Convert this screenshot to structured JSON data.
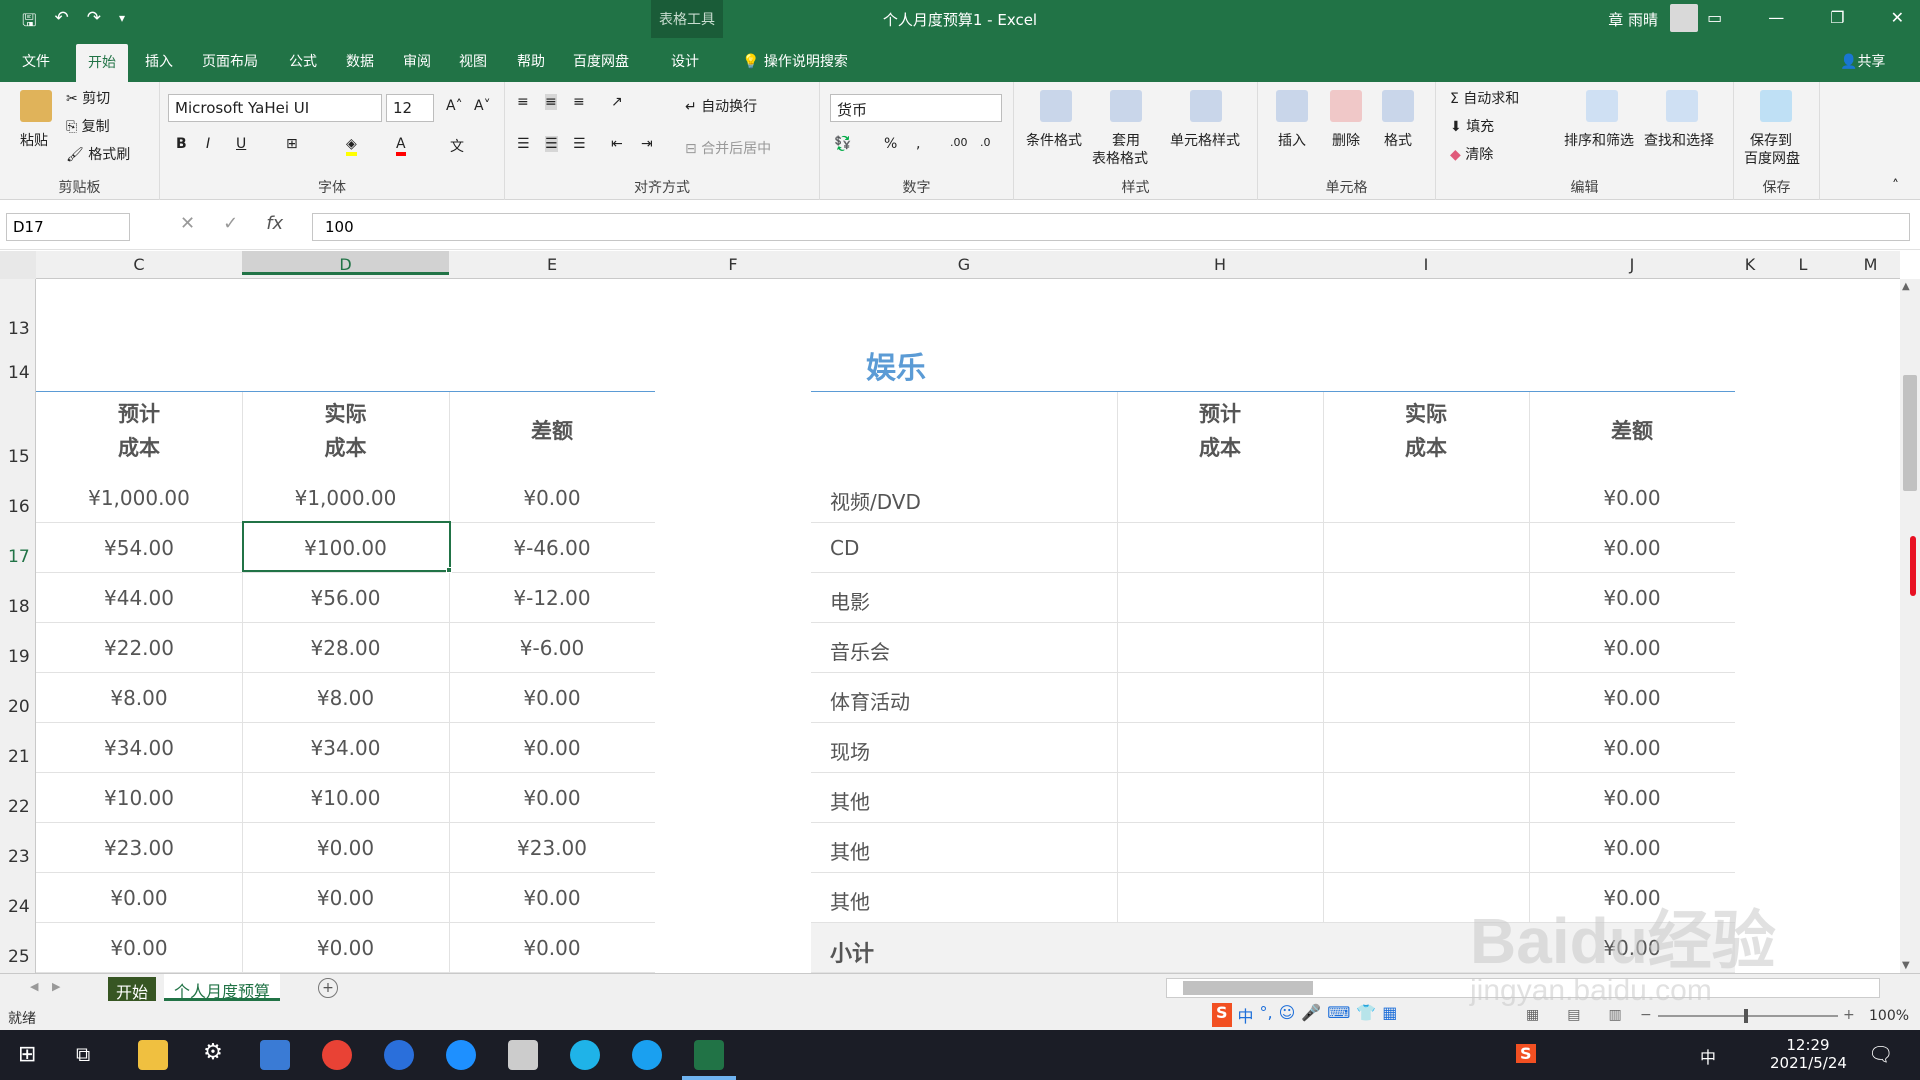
{
  "window": {
    "title": "个人月度预算1 - Excel",
    "context_tab": "表格工具",
    "user": "章 雨晴"
  },
  "tabs": [
    "文件",
    "开始",
    "插入",
    "页面布局",
    "公式",
    "数据",
    "审阅",
    "视图",
    "帮助",
    "百度网盘",
    "设计"
  ],
  "tell_me": "操作说明搜索",
  "share": "共享",
  "ribbon": {
    "clipboard": {
      "label": "剪贴板",
      "paste": "粘贴",
      "cut": "剪切",
      "copy": "复制",
      "format_painter": "格式刷"
    },
    "font": {
      "label": "字体",
      "name": "Microsoft YaHei UI",
      "size": "12"
    },
    "alignment": {
      "label": "对齐方式",
      "wrap": "自动换行",
      "merge": "合并后居中"
    },
    "number": {
      "label": "数字",
      "format": "货币"
    },
    "styles": {
      "label": "样式",
      "conditional": "条件格式",
      "table_format_1": "套用",
      "table_format_2": "表格格式",
      "cell_styles": "单元格样式"
    },
    "cells": {
      "label": "单元格",
      "insert": "插入",
      "delete": "删除",
      "format": "格式"
    },
    "editing": {
      "label": "编辑",
      "autosum": "自动求和",
      "fill": "填充",
      "clear": "清除",
      "sort": "排序和筛选",
      "find": "查找和选择"
    },
    "save": {
      "label": "保存",
      "save_1": "保存到",
      "save_2": "百度网盘"
    }
  },
  "formula_bar": {
    "name_box": "D17",
    "value": "100"
  },
  "columns": [
    "C",
    "D",
    "E",
    "F",
    "G",
    "H",
    "I",
    "J",
    "K",
    "L",
    "M"
  ],
  "rows": [
    "13",
    "14",
    "15",
    "16",
    "17",
    "18",
    "19",
    "20",
    "21",
    "22",
    "23",
    "24",
    "25"
  ],
  "section_title": "娱乐",
  "left_table": {
    "headers": [
      [
        "预计",
        "成本"
      ],
      [
        "实际",
        "成本"
      ],
      [
        "差额",
        ""
      ]
    ],
    "rows": [
      [
        "¥1,000.00",
        "¥1,000.00",
        "¥0.00"
      ],
      [
        "¥54.00",
        "¥100.00",
        "¥-46.00"
      ],
      [
        "¥44.00",
        "¥56.00",
        "¥-12.00"
      ],
      [
        "¥22.00",
        "¥28.00",
        "¥-6.00"
      ],
      [
        "¥8.00",
        "¥8.00",
        "¥0.00"
      ],
      [
        "¥34.00",
        "¥34.00",
        "¥0.00"
      ],
      [
        "¥10.00",
        "¥10.00",
        "¥0.00"
      ],
      [
        "¥23.00",
        "¥0.00",
        "¥23.00"
      ],
      [
        "¥0.00",
        "¥0.00",
        "¥0.00"
      ],
      [
        "¥0.00",
        "¥0.00",
        "¥0.00"
      ]
    ]
  },
  "right_table": {
    "headers": [
      [
        "预计",
        "成本"
      ],
      [
        "实际",
        "成本"
      ],
      [
        "差额",
        ""
      ]
    ],
    "rows": [
      [
        "视频/DVD",
        "¥0.00"
      ],
      [
        "CD",
        "¥0.00"
      ],
      [
        "电影",
        "¥0.00"
      ],
      [
        "音乐会",
        "¥0.00"
      ],
      [
        "体育活动",
        "¥0.00"
      ],
      [
        "现场",
        "¥0.00"
      ],
      [
        "其他",
        "¥0.00"
      ],
      [
        "其他",
        "¥0.00"
      ],
      [
        "其他",
        "¥0.00"
      ],
      [
        "小计",
        "¥0.00"
      ]
    ]
  },
  "sheets": [
    "开始",
    "个人月度预算"
  ],
  "status": {
    "ready": "就绪",
    "zoom": "100%"
  },
  "taskbar": {
    "time": "12:29",
    "date": "2021/5/24",
    "ime": "中"
  },
  "watermark": {
    "text1": "Baidu经验",
    "text2": "jingyan.baidu.com"
  },
  "colors": {
    "excel_green": "#217346",
    "header_blue": "#5b9bd5",
    "selection": "#217346"
  }
}
